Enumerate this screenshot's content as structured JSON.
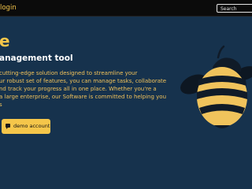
{
  "nav": {
    "login_label": "login",
    "search_placeholder": "Search"
  },
  "hero": {
    "title": "e",
    "subtitle": "anagement tool",
    "description_lines": [
      " cutting-edge solution designed to streamline your",
      "ur robust set of features, you can manage tasks, collaborate",
      "nd track your progress all in one place. Whether you're a",
      "a large enterprise, our Software is committed to helping you",
      "s"
    ],
    "demo_button_label": "demo account"
  },
  "colors": {
    "background": "#16324d",
    "navbar": "#0b0b0b",
    "accent": "#f5c64a",
    "bee_body": "#f0c35c",
    "bee_stripe": "#101b28",
    "bee_wing": "#0d1722"
  },
  "icons": {
    "demo_button_icon": "chat-bubble-icon",
    "illustration": "bee-illustration"
  }
}
